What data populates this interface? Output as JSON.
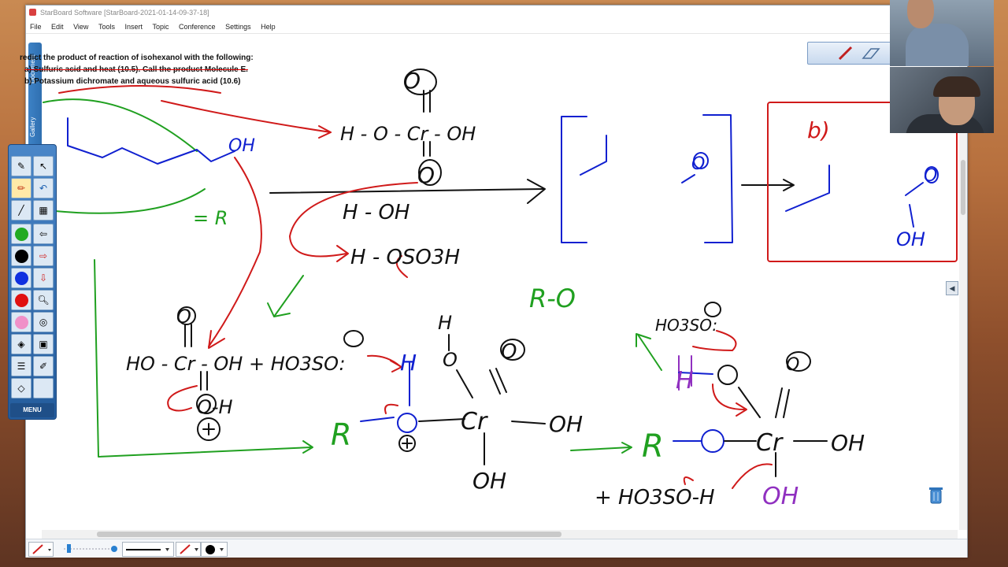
{
  "window": {
    "title": "StarBoard Software [StarBoard-2021-01-14-09-37-18]"
  },
  "menu": {
    "items": [
      "File",
      "Edit",
      "View",
      "Tools",
      "Insert",
      "Topic",
      "Conference",
      "Settings",
      "Help"
    ]
  },
  "side_tabs": {
    "document": "Document",
    "gallery": "Gallery"
  },
  "problem": {
    "line1": "redict the product of reaction of isohexanol with the following:",
    "line2": "a)  Sulfuric acid and heat (10.5).  Call the product Molecule E.",
    "line3": "b)  Potassium dichromate and aqueous sulfuric acid (10.6)"
  },
  "handwriting": {
    "oh_top": "OH",
    "r_label": "= R",
    "chromic_h": "H - O - Cr - OH",
    "chromic_o_top": "O",
    "chromic_o_bottom": "O",
    "water": "H - OH",
    "hydrogen_sulfate": "H - OSO3H",
    "b_label": "b)",
    "aldehyde_o": "O",
    "acid_o": "O",
    "acid_oh": "OH",
    "r_o": "R-O",
    "mid_left": "HO - Cr - OH + HO3SO:",
    "mid_left_oh": "O-H",
    "mid_left_top_o": "O",
    "mid_center_r": "R",
    "mid_center_h1": "H",
    "mid_center_h2": "H",
    "mid_center_o": "O",
    "mid_center_cr": "Cr",
    "mid_center_oh": "OH",
    "mid_center_oh_bottom": "OH",
    "mid_center_o_top": "O",
    "right_hso": "HO3SO:",
    "right_r": "R",
    "right_o": "O",
    "right_cr": "Cr",
    "right_oh": "OH",
    "right_h": "H",
    "right_o_top": "O",
    "right_oh_purple": "OH",
    "right_bottom": "+ HO3SO-H"
  },
  "toolbar": {
    "menu_label": "MENU",
    "colors": [
      "#22aa22",
      "#000000",
      "#1030e0",
      "#e01010",
      "#f090c8"
    ]
  },
  "icons": {
    "pen": "pen-icon",
    "eraser": "eraser-icon",
    "undo": "undo-icon",
    "select": "select-arrow-icon",
    "zoom": "zoom-icon",
    "trash": "trash-icon"
  }
}
